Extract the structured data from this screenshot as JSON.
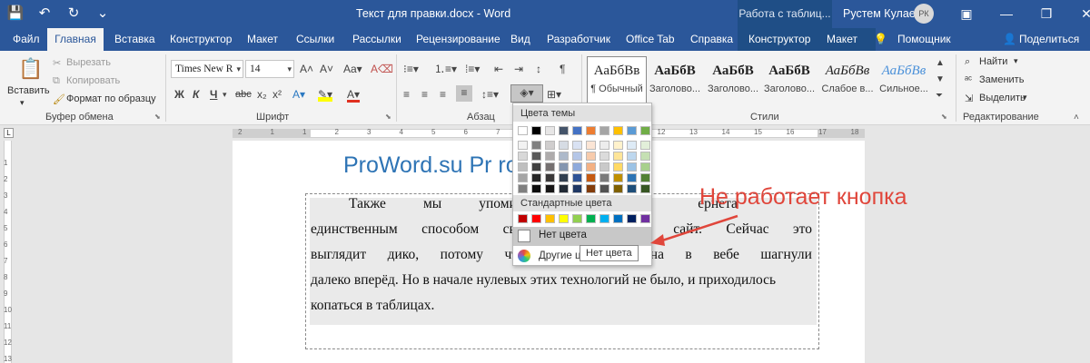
{
  "titlebar": {
    "document_title": "Текст для правки.docx - Word",
    "context_title": "Работа с таблиц...",
    "user_name": "Рустем Кулаев",
    "user_initials": "РК"
  },
  "tabs": [
    "Файл",
    "Главная",
    "Вставка",
    "Конструктор",
    "Макет",
    "Ссылки",
    "Рассылки",
    "Рецензирование",
    "Вид",
    "Разработчик",
    "Office Tab",
    "Справка",
    "Конструктор",
    "Макет",
    "Помощник",
    "Поделиться"
  ],
  "ribbon": {
    "clipboard": {
      "paste": "Вставить",
      "cut": "Вырезать",
      "copy": "Копировать",
      "format_painter": "Формат по образцу",
      "label": "Буфер обмена"
    },
    "font": {
      "font_name": "Times New R",
      "font_size": "14",
      "bold": "Ж",
      "italic": "К",
      "underline": "Ч",
      "strike": "abc",
      "label": "Шрифт"
    },
    "paragraph": {
      "label": "Абзац"
    },
    "styles": {
      "label": "Стили",
      "items": [
        {
          "sample": "АаБбВв",
          "name": "¶ Обычный"
        },
        {
          "sample": "АаБбВ",
          "name": "Заголово..."
        },
        {
          "sample": "АаБбВ",
          "name": "Заголово..."
        },
        {
          "sample": "АаБбВ",
          "name": "Заголово..."
        },
        {
          "sample": "АаБбВв",
          "name": "Слабое в..."
        },
        {
          "sample": "АаБбВв",
          "name": "Сильное..."
        }
      ]
    },
    "editing": {
      "find": "Найти",
      "replace": "Заменить",
      "select": "Выделить",
      "label": "Редактирование"
    }
  },
  "ruler": {
    "top_numbers": [
      "2",
      "1",
      "1",
      "2",
      "3",
      "4",
      "5",
      "6",
      "7",
      "8",
      "9",
      "10",
      "11",
      "12",
      "13",
      "14",
      "15",
      "16",
      "17",
      "18"
    ],
    "left_numbers": [
      "1",
      "2",
      "3",
      "4",
      "5",
      "6",
      "7",
      "8",
      "9",
      "10",
      "11",
      "12",
      "13"
    ]
  },
  "document": {
    "heading": "ProWord.su Pr          roWord.su",
    "lines": [
      [
        "Также",
        "мы",
        "упоминали,",
        "",
        "",
        "",
        "ернета",
        "",
        ""
      ],
      [
        "единственным",
        "способом",
        "свер",
        "",
        "",
        "",
        "ный",
        "сайт.",
        "Сейчас",
        "это"
      ],
      [
        "выглядит",
        "дико,",
        "потому",
        "что",
        "с",
        "",
        "",
        "дизайна",
        "в",
        "вебе",
        "шагнули"
      ],
      [
        "далеко вперёд. Но в начале нулевых этих технологий не было, и приходилось"
      ],
      [
        "копаться в таблицах."
      ]
    ]
  },
  "color_menu": {
    "theme_header": "Цвета темы",
    "theme_top": [
      "#ffffff",
      "#000000",
      "#e7e6e6",
      "#44546a",
      "#4472c4",
      "#ed7d31",
      "#a5a5a5",
      "#ffc000",
      "#5b9bd5",
      "#70ad47"
    ],
    "theme_shades": [
      [
        "#f2f2f2",
        "#7f7f7f",
        "#d0cece",
        "#d6dce4",
        "#d9e2f3",
        "#fbe5d5",
        "#ededed",
        "#fff2cc",
        "#deebf6",
        "#e2efd9"
      ],
      [
        "#d8d8d8",
        "#595959",
        "#aeabab",
        "#adb9ca",
        "#b4c6e7",
        "#f7cbac",
        "#dbdbdb",
        "#fee599",
        "#bdd7ee",
        "#c5e0b3"
      ],
      [
        "#bfbfbf",
        "#3f3f3f",
        "#757070",
        "#8496b0",
        "#8eaadb",
        "#f4b183",
        "#c9c9c9",
        "#ffd965",
        "#9cc3e5",
        "#a8d08d"
      ],
      [
        "#a5a5a5",
        "#262626",
        "#3a3838",
        "#323f4f",
        "#2f5496",
        "#c55a11",
        "#7b7b7b",
        "#bf8f00",
        "#2e75b5",
        "#538135"
      ],
      [
        "#7f7f7f",
        "#0c0c0c",
        "#171616",
        "#222a35",
        "#1f3864",
        "#833c0b",
        "#525252",
        "#7f6000",
        "#1e4e79",
        "#375623"
      ]
    ],
    "standard_header": "Стандартные цвета",
    "standard": [
      "#c00000",
      "#ff0000",
      "#ffc000",
      "#ffff00",
      "#92d050",
      "#00b050",
      "#00b0f0",
      "#0070c0",
      "#002060",
      "#7030a0"
    ],
    "no_color": "Нет цвета",
    "more_colors": "Другие ц",
    "tooltip": "Нет цвета"
  },
  "annotation": {
    "text": "Не работает кнопка",
    "color": "#e0463b"
  }
}
